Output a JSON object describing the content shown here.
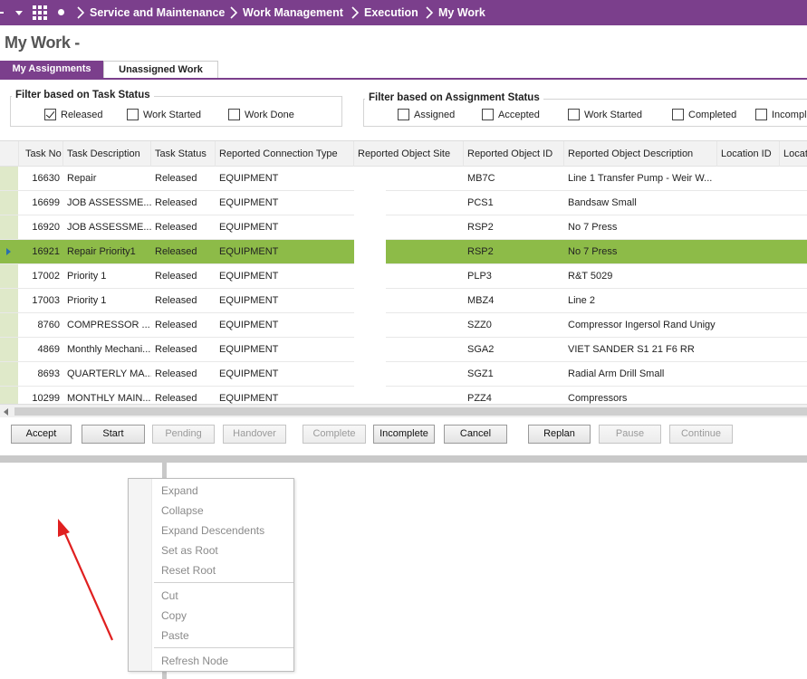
{
  "breadcrumb": [
    "Service and Maintenance",
    "Work Management",
    "Execution",
    "My Work"
  ],
  "page_title": "My Work -",
  "tabs": [
    {
      "label": "My Assignments",
      "active": true
    },
    {
      "label": "Unassigned Work",
      "active": false
    }
  ],
  "task_status_filter": {
    "legend": "Filter based on Task Status",
    "options": [
      {
        "label": "Released",
        "checked": true
      },
      {
        "label": "Work Started",
        "checked": false
      },
      {
        "label": "Work Done",
        "checked": false
      }
    ]
  },
  "assignment_status_filter": {
    "legend": "Filter based on Assignment Status",
    "options": [
      {
        "label": "Assigned",
        "checked": false
      },
      {
        "label": "Accepted",
        "checked": false
      },
      {
        "label": "Work Started",
        "checked": false
      },
      {
        "label": "Completed",
        "checked": false
      },
      {
        "label": "Incomplete",
        "checked": false
      }
    ]
  },
  "table": {
    "columns": [
      "Task No",
      "Task Description",
      "Task Status",
      "Reported Connection Type",
      "Reported Object Site",
      "Reported Object ID",
      "Reported Object Description",
      "Location ID",
      "Location"
    ],
    "rows": [
      {
        "task_no": "16630",
        "desc": "Repair",
        "status": "Released",
        "conn": "EQUIPMENT",
        "site": "",
        "obj_id": "MB7C",
        "obj_desc": "Line 1 Transfer Pump - Weir W...",
        "loc_id": "",
        "selected": false
      },
      {
        "task_no": "16699",
        "desc": "JOB ASSESSME...",
        "status": "Released",
        "conn": "EQUIPMENT",
        "site": "",
        "obj_id": "PCS1",
        "obj_desc": "Bandsaw Small",
        "loc_id": "",
        "selected": false
      },
      {
        "task_no": "16920",
        "desc": "JOB ASSESSME...",
        "status": "Released",
        "conn": "EQUIPMENT",
        "site": "",
        "obj_id": "RSP2",
        "obj_desc": "No 7 Press",
        "loc_id": "",
        "selected": false
      },
      {
        "task_no": "16921",
        "desc": "Repair Priority1",
        "status": "Released",
        "conn": "EQUIPMENT",
        "site": "",
        "obj_id": "RSP2",
        "obj_desc": "No 7 Press",
        "loc_id": "",
        "selected": true
      },
      {
        "task_no": "17002",
        "desc": "Priority 1",
        "status": "Released",
        "conn": "EQUIPMENT",
        "site": "",
        "obj_id": "PLP3",
        "obj_desc": "R&T 5029",
        "loc_id": "",
        "selected": false
      },
      {
        "task_no": "17003",
        "desc": "Priority 1",
        "status": "Released",
        "conn": "EQUIPMENT",
        "site": "",
        "obj_id": "MBZ4",
        "obj_desc": "Line 2",
        "loc_id": "",
        "selected": false
      },
      {
        "task_no": "8760",
        "desc": "COMPRESSOR ...",
        "status": "Released",
        "conn": "EQUIPMENT",
        "site": "",
        "obj_id": "SZZ0",
        "obj_desc": "Compressor Ingersol Rand Unigy",
        "loc_id": "",
        "selected": false
      },
      {
        "task_no": "4869",
        "desc": "Monthly Mechani...",
        "status": "Released",
        "conn": "EQUIPMENT",
        "site": "",
        "obj_id": "SGA2",
        "obj_desc": "VIET SANDER S1 21 F6 RR",
        "loc_id": "",
        "selected": false
      },
      {
        "task_no": "8693",
        "desc": "QUARTERLY MA...",
        "status": "Released",
        "conn": "EQUIPMENT",
        "site": "",
        "obj_id": "SGZ1",
        "obj_desc": "Radial Arm Drill Small",
        "loc_id": "",
        "selected": false
      },
      {
        "task_no": "10299",
        "desc": "MONTHLY MAIN...",
        "status": "Released",
        "conn": "EQUIPMENT",
        "site": "",
        "obj_id": "PZZ4",
        "obj_desc": "Compressors",
        "loc_id": "",
        "selected": false
      }
    ]
  },
  "actions": [
    {
      "label": "Accept",
      "enabled": true
    },
    {
      "label": "Start",
      "enabled": true
    },
    {
      "label": "Pending",
      "enabled": false
    },
    {
      "label": "Handover",
      "enabled": false
    },
    {
      "label": "Complete",
      "enabled": false
    },
    {
      "label": "Incomplete",
      "enabled": true
    },
    {
      "label": "Cancel",
      "enabled": true
    },
    {
      "label": "Replan",
      "enabled": true
    },
    {
      "label": "Pause",
      "enabled": false
    },
    {
      "label": "Continue",
      "enabled": false
    }
  ],
  "context_menu": {
    "groups": [
      [
        "Expand",
        "Collapse",
        "Expand Descendents",
        "Set as Root",
        "Reset Root"
      ],
      [
        "Cut",
        "Copy",
        "Paste"
      ],
      [
        "Refresh Node"
      ]
    ]
  },
  "colors": {
    "brand": "#7b3f8c",
    "selected_row": "#8dbb48",
    "annotation_arrow": "#e02020"
  },
  "icons": {
    "nav_menu": "grid-icon",
    "home": "dot-icon",
    "separator": "chevron-right-icon",
    "annotation": "red-arrow-icon"
  }
}
